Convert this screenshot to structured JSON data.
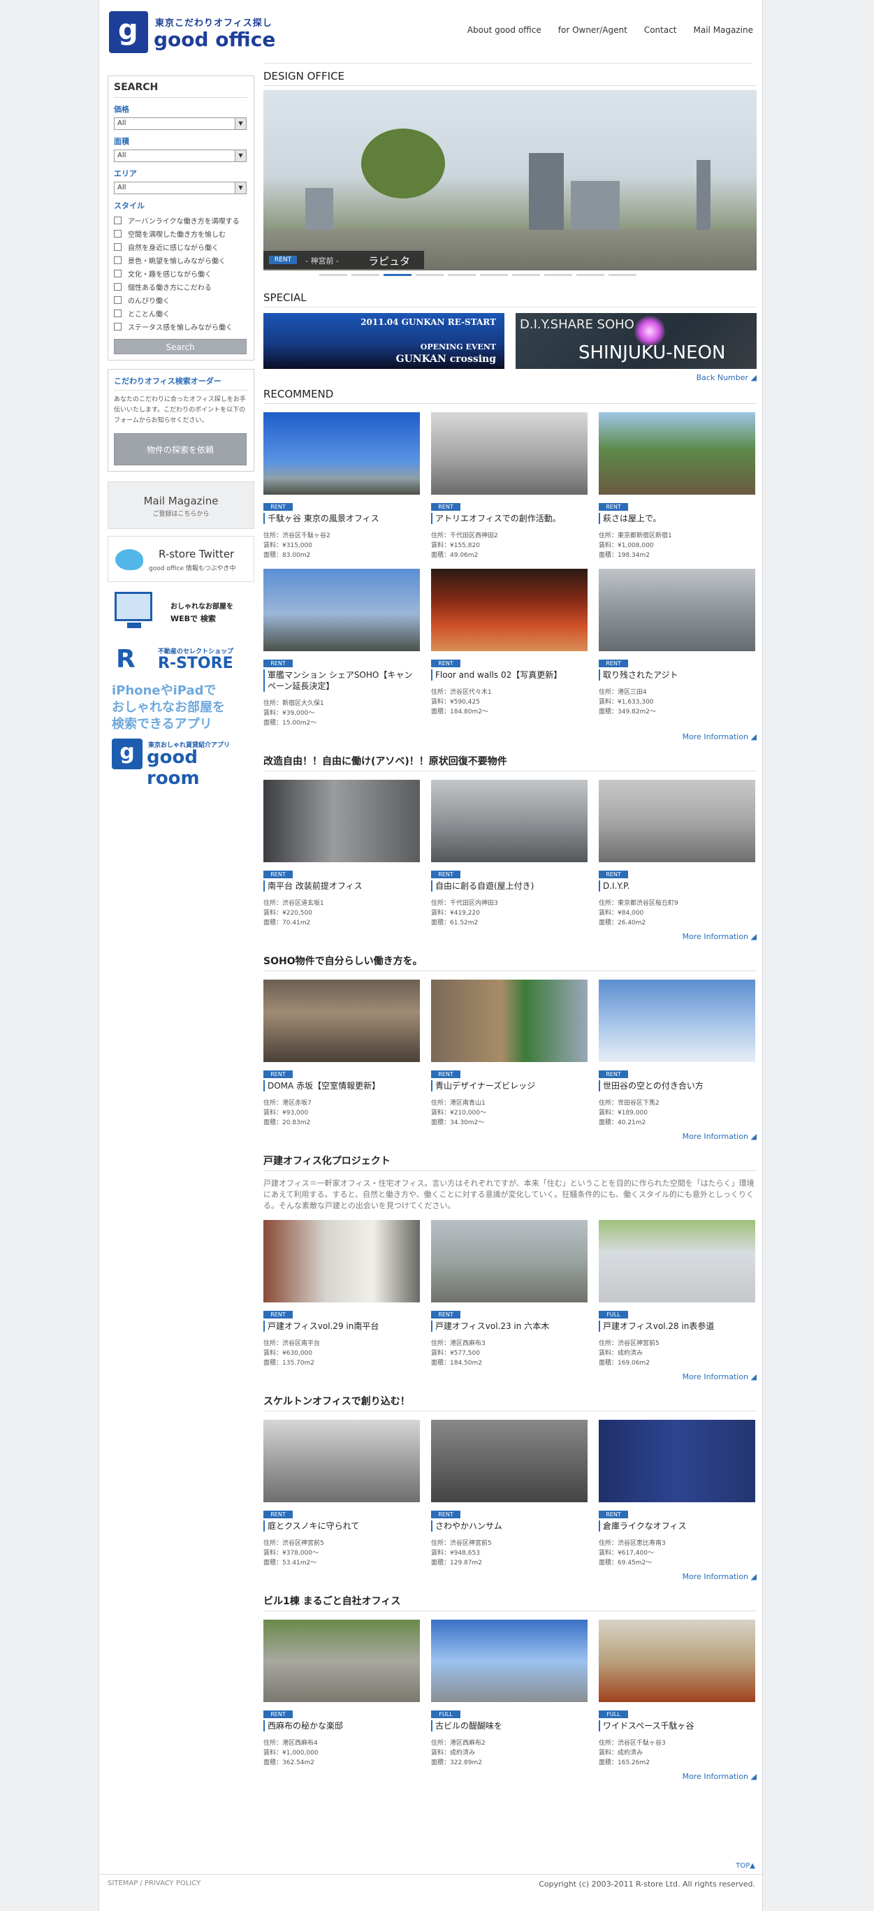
{
  "header": {
    "logo_sub": "東京こだわりオフィス探し",
    "logo_main": "good office",
    "nav": [
      "About good office",
      "for Owner/Agent",
      "Contact",
      "Mail Magazine"
    ]
  },
  "search": {
    "title": "SEARCH",
    "price_label": "価格",
    "area_label": "面積",
    "region_label": "エリア",
    "style_label": "スタイル",
    "select_value": "All",
    "styles": [
      "アーバンライクな働き方を満喫する",
      "空間を満喫した働き方を愉しむ",
      "自然を身近に感じながら働く",
      "景色・眺望を愉しみながら働く",
      "文化・趣を感じながら働く",
      "個性ある働き方にこだわる",
      "のんびり働く",
      "とことん働く",
      "ステータス感を愉しみながら働く"
    ],
    "button": "Search"
  },
  "order": {
    "title": "こだわりオフィス検索オーダー",
    "text": "あなたのこだわりに合ったオフィス探しをお手伝いいたします。こだわりのポイントを以下のフォームからお知らせください。",
    "button": "物件の探索を依頼"
  },
  "mail_magazine": {
    "title": "Mail Magazine",
    "sub": "ご登録はこちらから"
  },
  "twitter": {
    "title": "R-store Twitter",
    "sub": "good office 情報もつぶやき中"
  },
  "banner_pc": {
    "line1": "おしゃれなお部屋を",
    "line2": "WEBで 検索"
  },
  "rstore": {
    "sub": "不動産のセレクトショップ",
    "main": "R-STORE"
  },
  "app": {
    "line1": "iPhoneやiPadで",
    "line2": "おしゃれなお部屋を",
    "line3": "検索できるアプリ"
  },
  "goodroom": {
    "sub": "東京おしゃれ賃貸紹介アプリ",
    "main": "good room"
  },
  "design_office": {
    "title": "DESIGN OFFICE",
    "tag": "RENT",
    "area": "- 神宮前 -",
    "name": "ラピュタ"
  },
  "special": {
    "title": "SPECIAL",
    "banner1": {
      "line1": "2011.04 GUNKAN RE-START",
      "line2": "OPENING EVENT",
      "line3": "GUNKAN crossing"
    },
    "banner2": {
      "line1": "D.I.Y.SHARE SOHO",
      "line2": "SHINJUKU-NEON"
    },
    "back_number": "Back Number"
  },
  "sections": [
    {
      "title": "RECOMMEND",
      "more": "More Information",
      "rows": [
        [
          {
            "badge": "RENT",
            "title": "千駄ヶ谷 東京の風景オフィス",
            "address": "住所：渋谷区千駄ヶ谷2",
            "rent": "賃料：¥315,000",
            "size": "面積：83.00m2"
          },
          {
            "badge": "RENT",
            "title": "アトリエオフィスでの創作活動。",
            "address": "住所：千代田区西神田2",
            "rent": "賃料：¥155,820",
            "size": "面積：49.06m2"
          },
          {
            "badge": "RENT",
            "title": "萩さは屋上で。",
            "address": "住所：東京都新宿区新宿1",
            "rent": "賃料：¥1,008,000",
            "size": "面積：198.34m2"
          }
        ],
        [
          {
            "badge": "RENT",
            "title": "軍艦マンション シェアSOHO【キャンペーン延長決定】",
            "address": "住所：新宿区大久保1",
            "rent": "賃料：¥39,000〜",
            "size": "面積：15.00m2〜"
          },
          {
            "badge": "RENT",
            "title": "Floor and walls 02【写真更新】",
            "address": "住所：渋谷区代々木1",
            "rent": "賃料：¥590,425",
            "size": "面積：184.80m2〜"
          },
          {
            "badge": "RENT",
            "title": "取り残されたアジト",
            "address": "住所：港区三田4",
            "rent": "賃料：¥1,633,300",
            "size": "面積：349.82m2〜"
          }
        ]
      ]
    },
    {
      "title": "改造自由！！自由に働け(アソベ)！！原状回復不要物件",
      "more": "More Information",
      "rows": [
        [
          {
            "badge": "RENT",
            "title": "南平台 改装前提オフィス",
            "address": "住所：渋谷区道玄坂1",
            "rent": "賃料：¥220,500",
            "size": "面積：70.41m2"
          },
          {
            "badge": "RENT",
            "title": "自由に創る自遊(屋上付き)",
            "address": "住所：千代田区内神田3",
            "rent": "賃料：¥419,220",
            "size": "面積：61.52m2"
          },
          {
            "badge": "RENT",
            "title": "D.I.Y.P.",
            "address": "住所：東京都渋谷区桜丘町9",
            "rent": "賃料：¥84,000",
            "size": "面積：26.40m2"
          }
        ]
      ]
    },
    {
      "title": "SOHO物件で自分らしい働き方を。",
      "more": "More Information",
      "rows": [
        [
          {
            "badge": "RENT",
            "title": "DOMA 赤坂【空室情報更新】",
            "address": "住所：港区赤坂7",
            "rent": "賃料：¥93,000",
            "size": "面積：20.83m2"
          },
          {
            "badge": "RENT",
            "title": "青山デザイナーズビレッジ",
            "address": "住所：港区南青山1",
            "rent": "賃料：¥210,000〜",
            "size": "面積：34.30m2〜"
          },
          {
            "badge": "RENT",
            "title": "世田谷の空との付き合い方",
            "address": "住所：世田谷区下馬2",
            "rent": "賃料：¥189,000",
            "size": "面積：40.21m2"
          }
        ]
      ]
    },
    {
      "title": "戸建オフィス化プロジェクト",
      "description": "戸建オフィス＝一軒家オフィス・住宅オフィス。言い方はそれぞれですが、本来「住む」ということを目的に作られた空間を「はたらく」環境にあえて利用する。すると、自然と働き方や、働くことに対する意識が変化していく。狂騒条件的にも、働くスタイル的にも意外としっくりくる。そんな素敵な戸建との出会いを見つけてください。",
      "more": "More Information",
      "rows": [
        [
          {
            "badge": "RENT",
            "title": "戸建オフィスvol.29 in南平台",
            "address": "住所：渋谷区南平台",
            "rent": "賃料：¥630,000",
            "size": "面積：135.70m2"
          },
          {
            "badge": "RENT",
            "title": "戸建オフィスvol.23 in 六本木",
            "address": "住所：港区西麻布3",
            "rent": "賃料：¥577,500",
            "size": "面積：184.50m2"
          },
          {
            "badge": "FULL",
            "title": "戸建オフィスvol.28 in表参道",
            "address": "住所：渋谷区神宮前5",
            "rent": "賃料：成約済み",
            "size": "面積：169.06m2"
          }
        ]
      ]
    },
    {
      "title": "スケルトンオフィスで創り込む！",
      "more": "More Information",
      "rows": [
        [
          {
            "badge": "RENT",
            "title": "庭とクスノキに守られて",
            "address": "住所：渋谷区神宮前5",
            "rent": "賃料：¥378,000〜",
            "size": "面積：53.41m2〜"
          },
          {
            "badge": "RENT",
            "title": "さわやかハンサム",
            "address": "住所：渋谷区神宮前5",
            "rent": "賃料：¥948,653",
            "size": "面積：129.87m2"
          },
          {
            "badge": "RENT",
            "title": "倉庫ライクなオフィス",
            "address": "住所：渋谷区恵比寿南3",
            "rent": "賃料：¥617,400〜",
            "size": "面積：69.45m2〜"
          }
        ]
      ]
    },
    {
      "title": "ビル1棟 まるごと自社オフィス",
      "more": "More Information",
      "rows": [
        [
          {
            "badge": "RENT",
            "title": "西麻布の秘かな楽邸",
            "address": "住所：港区西麻布4",
            "rent": "賃料：¥1,000,000",
            "size": "面積：362.54m2"
          },
          {
            "badge": "FULL",
            "title": "古ビルの醍醐味を",
            "address": "住所：港区西麻布2",
            "rent": "賃料：成約済み",
            "size": "面積：322.89m2"
          },
          {
            "badge": "FULL",
            "title": "ワイドスペース千駄ヶ谷",
            "address": "住所：渋谷区千駄ヶ谷3",
            "rent": "賃料：成約済み",
            "size": "面積：165.26m2"
          }
        ]
      ]
    }
  ],
  "footer": {
    "top": "TOP",
    "links": "SITEMAP / PRIVACY POLICY",
    "copyright": "Copyright (c) 2003-2011 R-store Ltd. All rights reserved."
  }
}
